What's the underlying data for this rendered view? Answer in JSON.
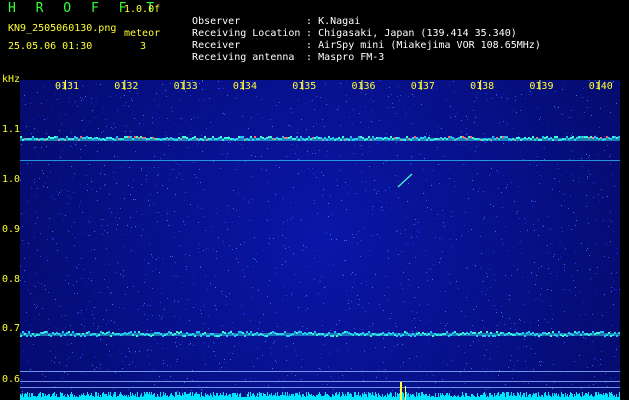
{
  "header": {
    "app_name": "H R O F F T",
    "version": "1.0.0f",
    "file_name": "KN9_2505060130.png",
    "meteor_label": "meteor",
    "meteor_count": "3",
    "datetime": "25.05.06 01:30"
  },
  "meta": [
    {
      "key": "Observer",
      "value": ": K.Nagai"
    },
    {
      "key": "Receiving Location",
      "value": ": Chigasaki, Japan (139.414 35.340)"
    },
    {
      "key": "Receiver",
      "value": ": AirSpy mini (Miakejima VOR 108.65MHz)"
    },
    {
      "key": "Receiving antenna",
      "value": ": Maspro FM-3"
    }
  ],
  "axis": {
    "y_unit": "kHz",
    "y_ticks": [
      "1.1",
      "1.0",
      "0.9",
      "0.8",
      "0.7",
      "0.6"
    ],
    "x_ticks": [
      "0131",
      "0132",
      "0133",
      "0134",
      "0135",
      "0136",
      "0137",
      "0138",
      "0139",
      "0140"
    ]
  },
  "colors": {
    "background": "#000000",
    "plot_bg": "#071086",
    "label": "#ffff33",
    "title": "#33ff33",
    "signal": "#33ffcc",
    "baseline": "#00e5ff"
  }
}
